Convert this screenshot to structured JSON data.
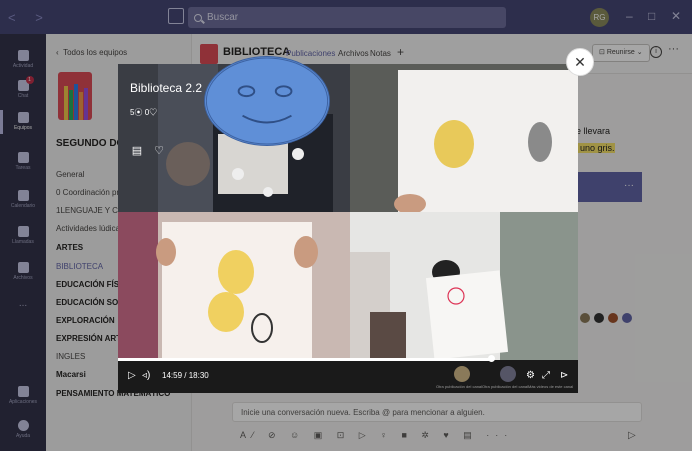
{
  "titlebar": {
    "search_placeholder": "Buscar",
    "avatar_initials": "RG"
  },
  "rail": {
    "items": [
      {
        "label": "Actividad"
      },
      {
        "label": "Chat",
        "badge": "1"
      },
      {
        "label": "Equipos"
      },
      {
        "label": "Tareas"
      },
      {
        "label": "Calendario"
      },
      {
        "label": "Llamadas"
      },
      {
        "label": "Archivos"
      },
      {
        "label": "..."
      },
      {
        "label": "Aplicaciones"
      },
      {
        "label": "Ayuda"
      }
    ]
  },
  "team_panel": {
    "back_label": "Todos los equipos",
    "team_name": "SEGUNDO DO",
    "channels": [
      {
        "label": "General",
        "style": "normal"
      },
      {
        "label": "0 Coordinación pro",
        "style": "normal"
      },
      {
        "label": "1LENGUAJE Y COM",
        "style": "normal"
      },
      {
        "label": "Actividades lúdicas",
        "style": "normal"
      },
      {
        "label": "ARTES",
        "style": "bold"
      },
      {
        "label": "BIBLIOTECA",
        "style": "selected"
      },
      {
        "label": "EDUCACIÓN FÍSIC",
        "style": "bold"
      },
      {
        "label": "EDUCACIÓN SOCI",
        "style": "bold"
      },
      {
        "label": "EXPLORACIÓN",
        "style": "bold"
      },
      {
        "label": "EXPRESIÓN ARTÍS",
        "style": "bold"
      },
      {
        "label": "INGLES",
        "style": "normal"
      },
      {
        "label": "Macarsi",
        "style": "bold"
      },
      {
        "label": "PENSAMIENTO MATEMÁTICO",
        "style": "bold"
      }
    ]
  },
  "channel": {
    "title": "BIBLIOTECA",
    "tabs": [
      "Publicaciones",
      "Archivos",
      "Notas"
    ],
    "meet_label": "Reunirse",
    "post_line1": "r se llevara",
    "post_line2": "llo, uno gris.",
    "compose_placeholder": "Inicie una conversación nueva. Escriba @ para mencionar a alguien."
  },
  "video": {
    "title": "Biblioteca 2.2",
    "views": "5",
    "likes": "0",
    "current_time": "14:59",
    "total_time": "18:30",
    "progress": 0.81,
    "related": [
      {
        "caption": "Otra publicación del canal"
      },
      {
        "caption": "Otra publicación del canal"
      },
      {
        "caption": "Más videos de este canal"
      }
    ]
  },
  "colors": {
    "titlebar": "#464775",
    "rail": "#33344a",
    "accent": "#6264a7",
    "highlight": "#f6e26b"
  }
}
